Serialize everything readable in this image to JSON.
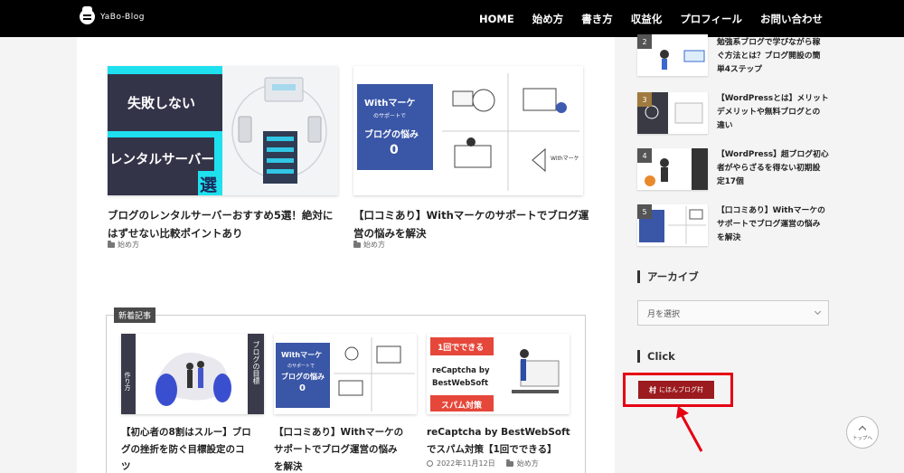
{
  "header": {
    "logo_text": "YaBo-Blog",
    "nav": [
      "HOME",
      "始め方",
      "書き方",
      "収益化",
      "プロフィール",
      "お問い合わせ"
    ]
  },
  "cards": [
    {
      "title_line1": "ブログのレンタルサーバーおすすめ5選！絶対に",
      "title_line2": "はずせない比較ポイントあり",
      "category": "始め方",
      "thumb_text": [
        "失敗しない",
        "レンタルサーバー",
        "選"
      ]
    },
    {
      "title_line1": "【口コミあり】Withマーケのサポートでブログ運",
      "title_line2": "営の悩みを解決",
      "category": "始め方",
      "thumb_text": [
        "Withマーケ",
        "のサポートで",
        "ブログの悩み",
        "0",
        "Withマーケ"
      ]
    }
  ],
  "new_posts": {
    "label": "新着記事",
    "items": [
      {
        "title": [
          "【初心者の8割はスルー】ブロ",
          "グの挫折を防ぐ目標設定のコ",
          "ツ"
        ],
        "thumb_text": [
          "ブログの目標",
          "作り方"
        ]
      },
      {
        "title": [
          "【口コミあり】Withマーケの",
          "サポートでブログ運営の悩み",
          "を解決"
        ],
        "thumb_text": [
          "Withマーケ",
          "のサポートで",
          "ブログの悩み",
          "0"
        ]
      },
      {
        "title": [
          "reCaptcha by BestWebSoft",
          "でスパム対策【1回でできる】"
        ],
        "date": "2022年11月12日",
        "category": "始め方",
        "thumb_text": [
          "1回でできる",
          "reCaptcha by",
          "BestWebSoft",
          "スパム対策"
        ]
      }
    ]
  },
  "sidebar": {
    "ranking": [
      {
        "rank": "2",
        "title": [
          "勉強系ブログで学びながら稼",
          "ぐ方法とは？ブログ開設の簡",
          "単4ステップ"
        ]
      },
      {
        "rank": "3",
        "title": [
          "【WordPressとは】メリット",
          "デメリットや無料ブログとの",
          "違い"
        ]
      },
      {
        "rank": "4",
        "title": [
          "【WordPress】超ブログ初心",
          "者がやらざるを得ない初期設",
          "定17個"
        ]
      },
      {
        "rank": "5",
        "title": [
          "【口コミあり】Withマーケの",
          "サポートでブログ運営の悩み",
          "を解決"
        ]
      }
    ],
    "archive_heading": "アーカイブ",
    "archive_select": "月を選択",
    "click_heading": "Click",
    "blog_button_mark": "村",
    "blog_button_text": "にほんブログ村"
  },
  "scroll_top_label": "トップへ",
  "colors": {
    "accent_red": "#e60012",
    "blog_button": "#9b1b1f",
    "header": "#000000"
  }
}
